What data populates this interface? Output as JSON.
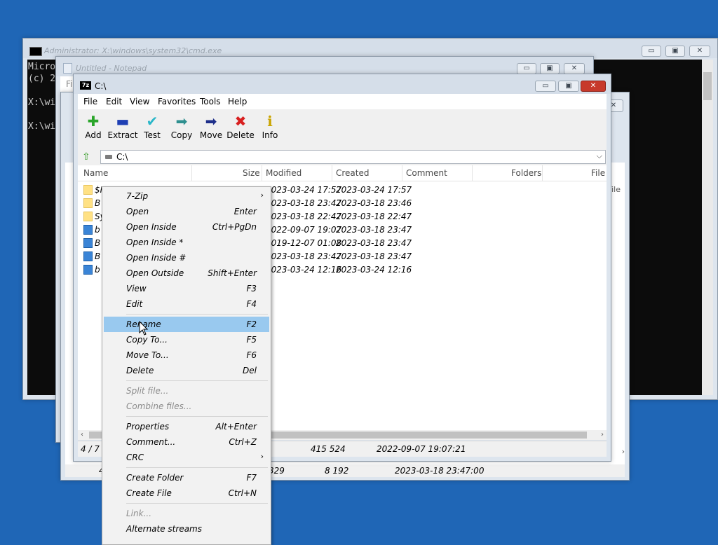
{
  "cmd": {
    "title": "Administrator: X:\\windows\\system32\\cmd.exe",
    "lines": [
      "Micro",
      "(c) 2",
      "",
      "X:\\wi",
      "",
      "X:\\wi"
    ]
  },
  "notepad": {
    "title": "Untitled - Notepad",
    "menu_first": "Fi"
  },
  "back_window": {
    "header_file_label": "File",
    "status_cells": [
      "4",
      "329",
      "8 192",
      "2023-03-18 23:47:00"
    ]
  },
  "zip": {
    "title": "C:\\",
    "menu": [
      "File",
      "Edit",
      "View",
      "Favorites",
      "Tools",
      "Help"
    ],
    "toolbar": [
      {
        "label": "Add",
        "icon": "add-icon",
        "glyph": "✚",
        "color": "#2aa52a"
      },
      {
        "label": "Extract",
        "icon": "extract-icon",
        "glyph": "▬",
        "color": "#1e3fb4"
      },
      {
        "label": "Test",
        "icon": "test-icon",
        "glyph": "✔",
        "color": "#2bb7c9"
      },
      {
        "label": "Copy",
        "icon": "copy-icon",
        "glyph": "➡",
        "color": "#2e8f8f"
      },
      {
        "label": "Move",
        "icon": "move-icon",
        "glyph": "➡",
        "color": "#1e2f8a"
      },
      {
        "label": "Delete",
        "icon": "delete-icon",
        "glyph": "✖",
        "color": "#d81f1f"
      },
      {
        "label": "Info",
        "icon": "info-icon",
        "glyph": "ℹ",
        "color": "#c9a400"
      }
    ],
    "address": "C:\\",
    "columns": [
      "Name",
      "Size",
      "Modified",
      "Created",
      "Comment",
      "Folders",
      "File"
    ],
    "rows": [
      {
        "name": "$RECYCLE.BIN",
        "type": "folder",
        "modified": "2023-03-24 17:57",
        "created": "2023-03-24 17:57"
      },
      {
        "name": "B",
        "type": "folder",
        "modified": "2023-03-18 23:47",
        "created": "2023-03-18 23:46"
      },
      {
        "name": "Sy",
        "type": "folder",
        "modified": "2023-03-18 22:47",
        "created": "2023-03-18 22:47"
      },
      {
        "name": "b",
        "type": "file",
        "modified": "2022-09-07 19:07",
        "created": "2023-03-18 23:47"
      },
      {
        "name": "B",
        "type": "file",
        "modified": "2019-12-07 01:08",
        "created": "2023-03-18 23:47"
      },
      {
        "name": "B",
        "type": "file",
        "modified": "2023-03-18 23:47",
        "created": "2023-03-18 23:47"
      },
      {
        "name": "b",
        "type": "file",
        "modified": "2023-03-24 12:16",
        "created": "2023-03-24 12:16"
      }
    ],
    "status": {
      "selection": "4 / 7 o",
      "size": "415 524",
      "date": "2022-09-07 19:07:21"
    }
  },
  "context_menu": {
    "items": [
      {
        "label": "7-Zip",
        "submenu": true
      },
      {
        "label": "Open",
        "shortcut": "Enter"
      },
      {
        "label": "Open Inside",
        "shortcut": "Ctrl+PgDn"
      },
      {
        "label": "Open Inside *"
      },
      {
        "label": "Open Inside #"
      },
      {
        "label": "Open Outside",
        "shortcut": "Shift+Enter"
      },
      {
        "label": "View",
        "shortcut": "F3"
      },
      {
        "label": "Edit",
        "shortcut": "F4"
      },
      {
        "sep": true
      },
      {
        "label": "Rename",
        "shortcut": "F2",
        "selected": true
      },
      {
        "label": "Copy To...",
        "shortcut": "F5"
      },
      {
        "label": "Move To...",
        "shortcut": "F6"
      },
      {
        "label": "Delete",
        "shortcut": "Del"
      },
      {
        "sep": true
      },
      {
        "label": "Split file...",
        "disabled": true
      },
      {
        "label": "Combine files...",
        "disabled": true
      },
      {
        "sep": true
      },
      {
        "label": "Properties",
        "shortcut": "Alt+Enter"
      },
      {
        "label": "Comment...",
        "shortcut": "Ctrl+Z"
      },
      {
        "label": "CRC",
        "submenu": true
      },
      {
        "sep": true
      },
      {
        "label": "Create Folder",
        "shortcut": "F7"
      },
      {
        "label": "Create File",
        "shortcut": "Ctrl+N"
      },
      {
        "sep": true
      },
      {
        "label": "Link...",
        "disabled": true
      },
      {
        "label": "Alternate streams"
      }
    ]
  }
}
